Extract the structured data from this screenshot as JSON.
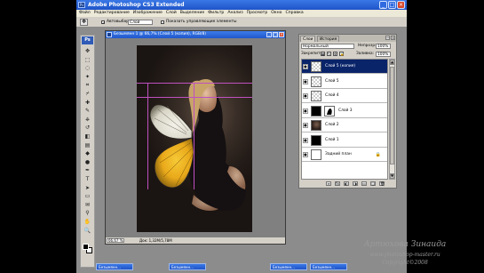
{
  "window": {
    "title": "Adobe Photoshop CS3 Extended",
    "logo": "Ps",
    "buttons": [
      "_",
      "□",
      "×"
    ]
  },
  "menu": [
    "Файл",
    "Редактирование",
    "Изображение",
    "Слой",
    "Выделение",
    "Фильтр",
    "Анализ",
    "Просмотр",
    "Окно",
    "Справка"
  ],
  "options_bar": {
    "tool_icon": "move-tool-icon",
    "autoselect_label": "Автовыбор:",
    "autoselect_value": "Слой",
    "show_controls_label": "Показать управляющие элементы"
  },
  "toolbox": {
    "logo": "Ps",
    "tools": [
      "move-tool-icon",
      "marquee-tool-icon",
      "lasso-tool-icon",
      "magic-wand-icon",
      "crop-tool-icon",
      "slice-tool-icon",
      "healing-brush-icon",
      "brush-tool-icon",
      "clone-stamp-icon",
      "history-brush-icon",
      "eraser-tool-icon",
      "gradient-tool-icon",
      "blur-tool-icon",
      "dodge-tool-icon",
      "pen-tool-icon",
      "type-tool-icon",
      "path-selection-icon",
      "shape-tool-icon",
      "notes-tool-icon",
      "eyedropper-tool-icon",
      "hand-tool-icon",
      "zoom-tool-icon"
    ],
    "glyphs": [
      "✥",
      "⬚",
      "◌",
      "✦",
      "⌗",
      "⌿",
      "✚",
      "✎",
      "⎈",
      "↺",
      "◧",
      "▤",
      "◆",
      "●",
      "✒",
      "T",
      "➤",
      "▭",
      "✉",
      "⚲",
      "✋",
      "🔍"
    ],
    "foreground_color": "#000000",
    "background_color": "#ffffff"
  },
  "document": {
    "title": "Безымянн 1 @ 66,7% (Слой 5 (копия), RGB/8)",
    "zoom": "66,67 %",
    "doc_size": "Док: 1,32M/5,78M",
    "buttons": [
      "_",
      "□",
      "×"
    ]
  },
  "layers_panel": {
    "tabs": [
      "Слои",
      "История"
    ],
    "blend_mode": "Нормальный",
    "opacity_label": "Непрозр:",
    "opacity_value": "100%",
    "lock_label": "Закрепить:",
    "fill_label": "Заливка:",
    "fill_value": "100%",
    "layers": [
      {
        "name": "Слой 5 (копия)",
        "selected": true,
        "thumb": "checker"
      },
      {
        "name": "Слой 5",
        "selected": false,
        "thumb": "checker"
      },
      {
        "name": "Слой 4",
        "selected": false,
        "thumb": "checker"
      },
      {
        "name": "Слой 3",
        "selected": false,
        "thumb": "black",
        "has_mask": true
      },
      {
        "name": "Слой 2",
        "selected": false,
        "thumb": "photo"
      },
      {
        "name": "Слой 1",
        "selected": false,
        "thumb": "black"
      },
      {
        "name": "Задний план",
        "selected": false,
        "thumb": "white",
        "locked": true
      }
    ],
    "footer_icons": [
      "link-layers-icon",
      "layer-style-icon",
      "add-mask-icon",
      "adjustment-layer-icon",
      "new-group-icon",
      "new-layer-icon",
      "delete-layer-icon"
    ]
  },
  "minimized_docs": [
    "Безымянн...",
    "Безымянн...",
    "Безымянн...",
    "Безымянн..."
  ],
  "watermark": {
    "line1": "Артюхова Зинаида",
    "line2": "www.photoshop-master.ru",
    "line3": "Copyright©2008"
  },
  "colors": {
    "titlebar": "#2558cc",
    "selected_layer": "#0a246a",
    "guide": "#c050c0"
  }
}
